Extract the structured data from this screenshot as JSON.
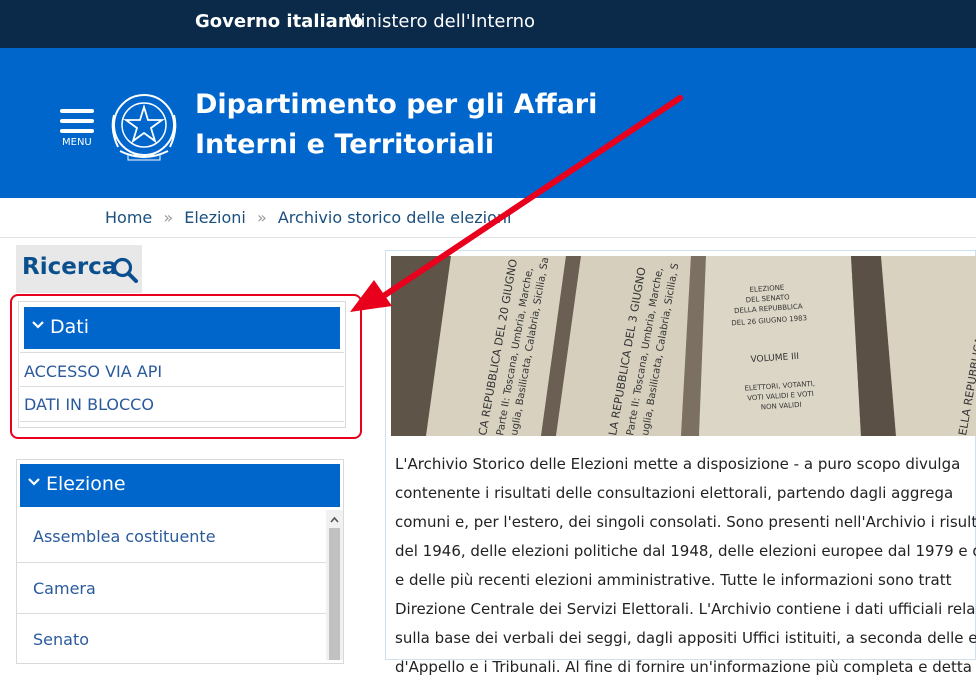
{
  "topbar": {
    "gov": "Governo italiano",
    "ministry": "Ministero dell'Interno"
  },
  "header": {
    "menu_label": "MENU",
    "title_line1": "Dipartimento per gli Affari",
    "title_line2": "Interni e Territoriali"
  },
  "breadcrumb": {
    "items": [
      "Home",
      "Elezioni",
      "Archivio storico delle elezioni"
    ],
    "separator": "»"
  },
  "search": {
    "label": "Ricerca"
  },
  "dati": {
    "title": "Dati",
    "links": [
      "ACCESSO VIA API",
      "DATI IN BLOCCO"
    ]
  },
  "elezione": {
    "title": "Elezione",
    "items": [
      "Assemblea costituente",
      "Camera",
      "Senato"
    ]
  },
  "photo": {
    "volume_label": "VOLUME III",
    "elezione_text": [
      "ELEZIONE",
      "DEL SENATO",
      "DELLA REPUBBLICA",
      "DEL 26 GIUGNO 1983"
    ],
    "voti_text": [
      "ELETTORI, VOTANTI,",
      "VOTI VALIDI E VOTI",
      "NON VALIDI"
    ],
    "spine1": [
      "CA REPUBBLICA DEL 20 GIUGNO",
      "Parte II: Toscana, Umbria, Marche,",
      "uglia, Basilicata, Calabria, Sicilia, Sa"
    ],
    "spine2": [
      "LA REPUBBLICA DEL 3 GIUGNO",
      "Parte II: Toscana, Umbria, Marche,",
      "uglia, Basilicata, Calabria, Sicilia, S"
    ],
    "spine3": [
      "ELLA REPUBBLICA DEL 3 GIU"
    ]
  },
  "content": {
    "lines": [
      "L'Archivio Storico delle Elezioni mette a disposizione - a puro scopo divulga",
      "contenente i risultati delle consultazioni elettorali, partendo dagli aggrega",
      "comuni e, per l'estero, dei singoli consolati. Sono presenti nell'Archivio i risult",
      "del 1946, delle elezioni politiche dal 1948, delle elezioni europee dal 1979 e d",
      "e delle più recenti elezioni amministrative. Tutte le informazioni sono tratt",
      "Direzione Centrale dei Servizi Elettorali. L'Archivio contiene i dati ufficiali rela",
      "sulla base dei verbali dei seggi, dagli appositi Uffici istituiti, a seconda delle el",
      "d'Appello e i Tribunali. Al fine di fornire un'informazione più completa e detta"
    ]
  },
  "colors": {
    "topbar": "#0b2a4a",
    "header": "#0066cc",
    "highlight": "#e8001c"
  }
}
